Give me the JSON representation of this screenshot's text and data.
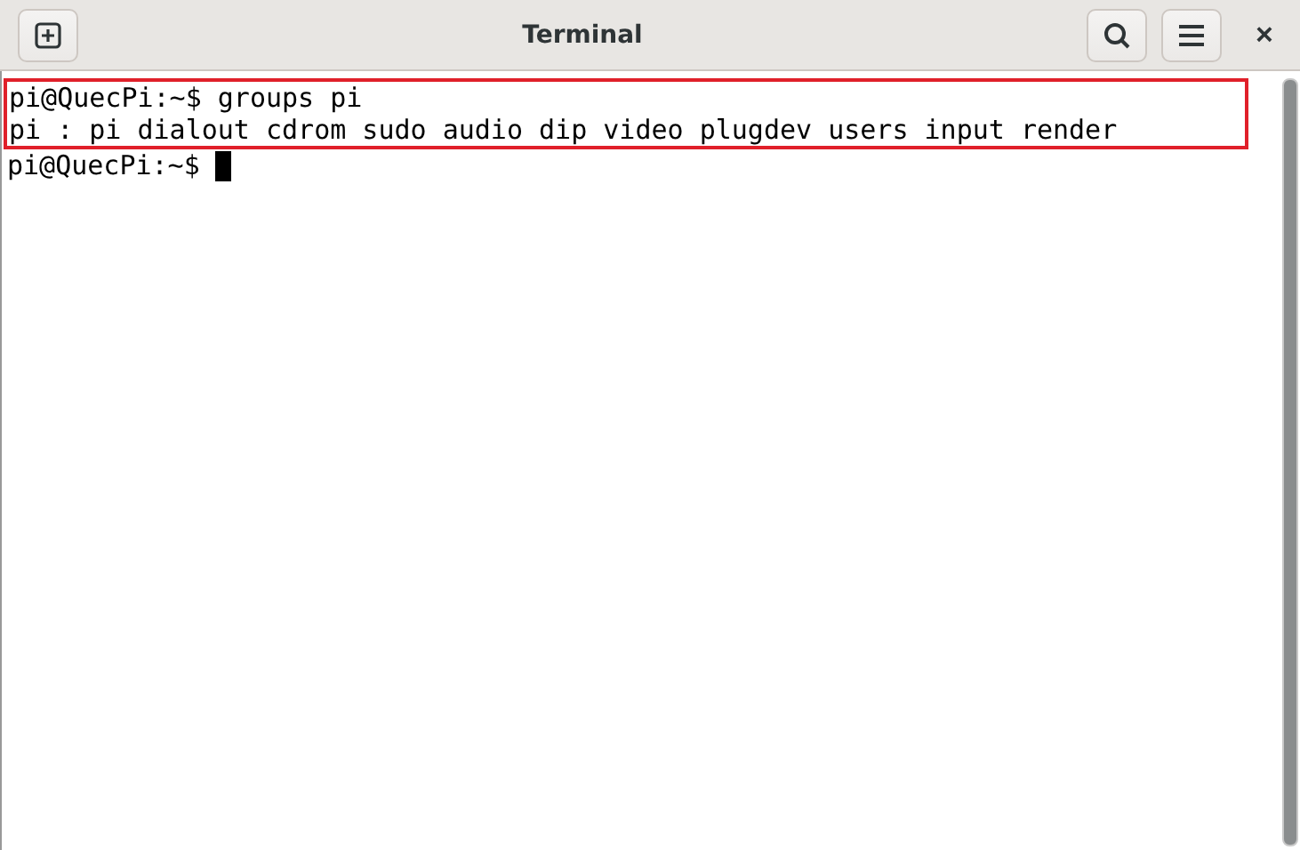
{
  "window": {
    "title": "Terminal",
    "close": "×"
  },
  "terminal": {
    "highlighted_lines": [
      "pi@QuecPi:~$ groups pi",
      "pi : pi dialout cdrom sudo audio dip video plugdev users input render"
    ],
    "prompt": "pi@QuecPi:~$",
    "cursor": true
  }
}
